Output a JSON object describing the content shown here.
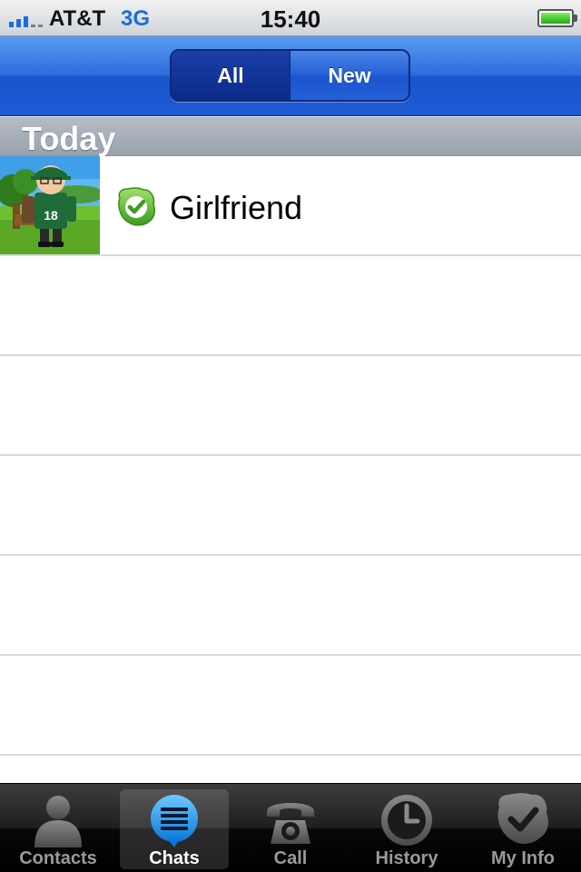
{
  "status_bar": {
    "carrier": "AT&T",
    "network": "3G",
    "time": "15:40",
    "signal_bars_active": 3,
    "signal_bars_total": 5,
    "battery_level": 1.0
  },
  "nav": {
    "segments": [
      {
        "label": "All",
        "selected": true
      },
      {
        "label": "New",
        "selected": false
      }
    ]
  },
  "section": {
    "title": "Today"
  },
  "chats": [
    {
      "name": "Girlfriend",
      "status": "online",
      "status_icon": "skype-online-check-icon",
      "avatar_icon": "avatar-character-18-jersey"
    }
  ],
  "empty_row_count": 5,
  "tabs": [
    {
      "label": "Contacts",
      "icon": "contacts-person-icon",
      "active": false
    },
    {
      "label": "Chats",
      "icon": "chats-bubble-icon",
      "active": true
    },
    {
      "label": "Call",
      "icon": "call-phone-icon",
      "active": false
    },
    {
      "label": "History",
      "icon": "history-clock-icon",
      "active": false
    },
    {
      "label": "My Info",
      "icon": "my-info-check-icon",
      "active": false
    }
  ],
  "colors": {
    "accent": "#2c6de0",
    "network": "#1a6fd8",
    "online": "#4fb82a"
  }
}
